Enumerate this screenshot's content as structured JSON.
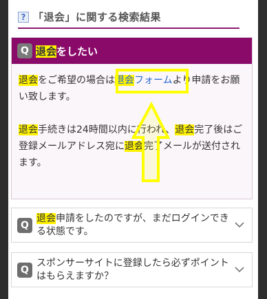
{
  "search": {
    "help_glyph": "?",
    "title": "「退会」に関する検索結果"
  },
  "open_question": {
    "badge": "Q",
    "keyword": "退会",
    "rest": "をしたい"
  },
  "answer": {
    "p1_kw1": "退会",
    "p1_t1": "をご希望の場合は",
    "p1_link_kw": "退会",
    "p1_link_rest": "フォーム",
    "p1_t2": "より申請をお願い致します。",
    "p2_kw1": "退会",
    "p2_t1": "手続きは24時間以内に行われ、",
    "p2_kw2": "退会",
    "p2_t2": "完了後はご登録メールアドレス宛に",
    "p2_kw3": "退会",
    "p2_t3": "完了メールが送付されます。"
  },
  "questions": [
    {
      "badge": "Q",
      "keyword": "退会",
      "rest": "申請をしたのですが、まだログインできる状態です。"
    },
    {
      "badge": "Q",
      "keyword": "",
      "rest": "スポンサーサイトに登録したら必ずポイントはもらえますか？"
    }
  ],
  "colors": {
    "accent": "#8a0a6a",
    "highlight": "#fff200",
    "annotation": "#ffff00",
    "link": "#2a6ad0"
  },
  "icons": [
    "help-icon",
    "q-icon",
    "chevron-down-icon",
    "arrow-up-annotation"
  ]
}
